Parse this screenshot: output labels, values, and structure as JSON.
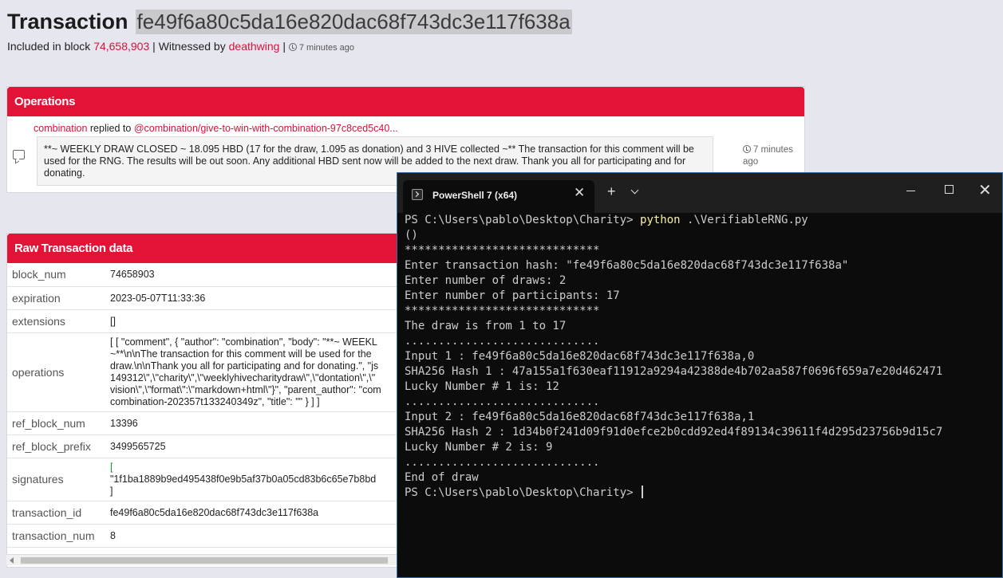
{
  "header": {
    "title_label": "Transaction",
    "tx_hash": "fe49f6a80c5da16e820dac68f743dc3e117f638a",
    "included_text": "Included in block",
    "block_num": "74,658,903",
    "sep1": "|",
    "witnessed_text": "Witnessed by",
    "witness": "deathwing",
    "sep2": "|",
    "time_ago": "7 minutes ago"
  },
  "operations": {
    "title": "Operations",
    "author": "combination",
    "action": "replied to",
    "parent_link": "@combination/give-to-win-with-combination-97c8ced5c40...",
    "body": "**~ WEEKLY DRAW CLOSED ~ 18.095 HBD (17 for the draw, 1.095 as donation) and 3 HIVE collected ~** The transaction for this comment will be used for the RNG. The results will be out soon. Any additional HBD sent now will be added to the next draw. Thank you all for participating and for donating.",
    "time_line1": "7 minutes",
    "time_line2": "ago"
  },
  "raw": {
    "title": "Raw Transaction data",
    "rows": [
      {
        "key": "block_num",
        "value": "74658903"
      },
      {
        "key": "expiration",
        "value": "2023-05-07T11:33:36"
      },
      {
        "key": "extensions",
        "value": "[]"
      },
      {
        "key": "operations",
        "lines": [
          "[ [ \"comment\", { \"author\": \"combination\", \"body\": \"**~ WEEKL",
          "~**\\n\\nThe transaction for this comment will be used for the",
          "draw.\\n\\nThank you all for participating and for donating.\", \"js",
          "149312\\\",\\\"charity\\\",\\\"weeklyhivecharitydraw\\\",\\\"dontation\\\",\\\"",
          "vision\\\",\\\"format\\\":\\\"markdown+html\\\"}\", \"parent_author\": \"com",
          "combination-202357t133240349z\", \"title\": \"\" } ] ]"
        ]
      },
      {
        "key": "ref_block_num",
        "value": "13396"
      },
      {
        "key": "ref_block_prefix",
        "value": "3499565725"
      },
      {
        "key": "signatures",
        "lines": [
          "[",
          "\"1f1ba1889b9ed495438f0e9b5af37b0a05cd83b6c65e7b8bd",
          "]"
        ]
      },
      {
        "key": "transaction_id",
        "value": "fe49f6a80c5da16e820dac68f743dc3e117f638a"
      },
      {
        "key": "transaction_num",
        "value": "8"
      }
    ]
  },
  "terminal": {
    "tab_title": "PowerShell 7 (x64)",
    "close_glyph": "✕",
    "newtab_glyph": "+",
    "winclose_glyph": "✕",
    "lines": [
      {
        "prompt": "PS C:\\Users\\pablo\\Desktop\\Charity> ",
        "cmd": "python",
        "rest": " .\\VerifiableRNG.py"
      },
      {
        "text": "()"
      },
      {
        "text": "*****************************"
      },
      {
        "text": "Enter transaction hash: \"fe49f6a80c5da16e820dac68f743dc3e117f638a\""
      },
      {
        "text": "Enter number of draws: 2"
      },
      {
        "text": "Enter number of participants: 17"
      },
      {
        "text": "*****************************"
      },
      {
        "text": "The draw is from 1 to 17"
      },
      {
        "text": "............................."
      },
      {
        "text": "Input 1 : fe49f6a80c5da16e820dac68f743dc3e117f638a,0"
      },
      {
        "text": "SHA256 Hash 1 : 47a155a1f630eaf11912a9294a42388de4b702aa587f0696f659a7e20d462471"
      },
      {
        "text": "Lucky Number # 1 is: 12"
      },
      {
        "text": "............................."
      },
      {
        "text": "Input 2 : fe49f6a80c5da16e820dac68f743dc3e117f638a,1"
      },
      {
        "text": "SHA256 Hash 2 : 1d34b0f241d09f91d0efce2b0cdd92ed4f89134c39611f4d295d23756b9d15c7"
      },
      {
        "text": "Lucky Number # 2 is: 9"
      },
      {
        "text": "............................."
      },
      {
        "text": "End of draw"
      },
      {
        "text": "PS C:\\Users\\pablo\\Desktop\\Charity> "
      }
    ]
  }
}
